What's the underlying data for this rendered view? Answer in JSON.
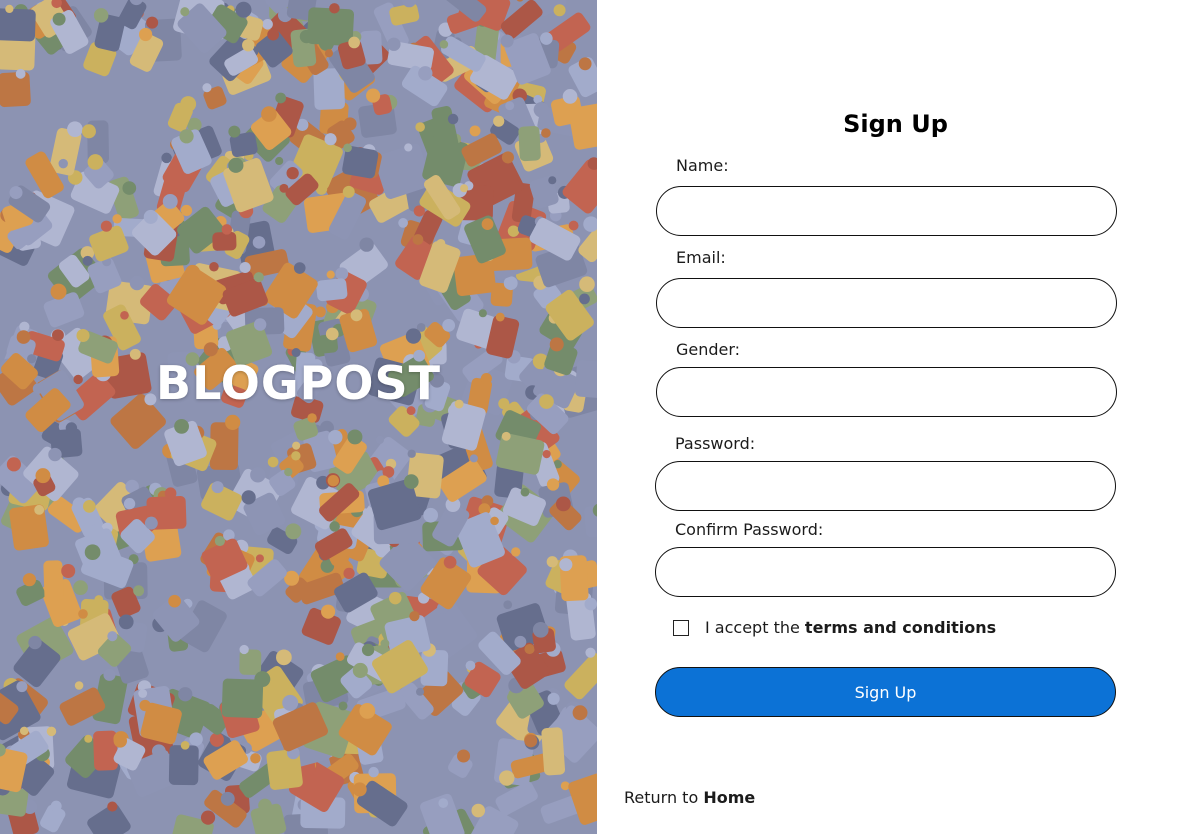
{
  "hero": {
    "title": "BLOGPOST",
    "background": "jigsaw-puzzle-pieces-photo"
  },
  "form": {
    "title": "Sign Up",
    "fields": [
      {
        "label": "Name:",
        "value": "",
        "placeholder": ""
      },
      {
        "label": "Email:",
        "value": "",
        "placeholder": ""
      },
      {
        "label": "Gender:",
        "value": "",
        "placeholder": ""
      },
      {
        "label": "Password:",
        "value": "",
        "placeholder": ""
      },
      {
        "label": "Confirm Password:",
        "value": "",
        "placeholder": ""
      }
    ],
    "terms": {
      "prefix": "I accept the",
      "link": "terms and conditions",
      "checked": false
    },
    "submit_label": "Sign Up",
    "return": {
      "prefix": "Return to",
      "link": "Home"
    }
  },
  "colors": {
    "button": "#0c72d6",
    "button_text": "#ffffff",
    "hero_title": "#ffffff"
  }
}
